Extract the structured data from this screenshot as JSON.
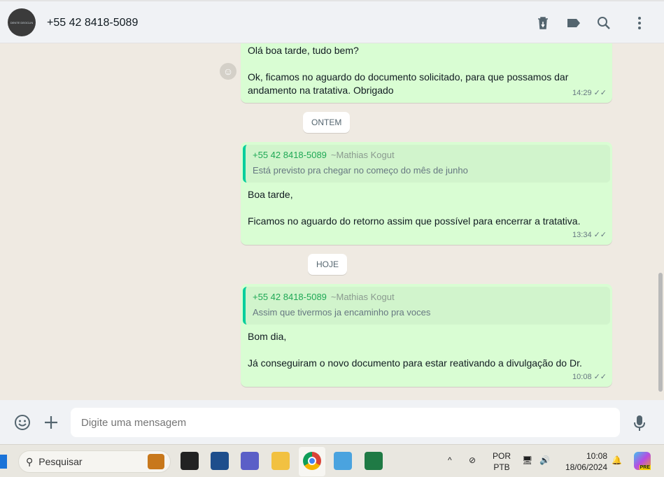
{
  "header": {
    "contact": "+55 42 8418-5089",
    "avatar_text": "DENTE DEOCLIN"
  },
  "messages": [
    {
      "lines": [
        "Olá boa tarde, tudo bem?",
        "",
        "Ok, ficamos no aguardo do documento solicitado, para que possamos dar andamento na tratativa. Obrigado"
      ],
      "time": "14:29"
    },
    {
      "quote": {
        "name": "+55 42 8418-5089",
        "alias": "~Mathias Kogut",
        "text": "Está previsto pra chegar no começo do mês de junho"
      },
      "lines": [
        "Boa tarde,",
        "",
        "Ficamos no aguardo do retorno assim que possível para encerrar a tratativa."
      ],
      "time": "13:34"
    },
    {
      "quote": {
        "name": "+55 42 8418-5089",
        "alias": "~Mathias Kogut",
        "text": "Assim que tivermos ja encaminho pra voces"
      },
      "lines": [
        "Bom dia,",
        "",
        "Já conseguiram o novo documento para estar reativando a divulgação do Dr."
      ],
      "time": "10:08"
    }
  ],
  "dates": [
    "ONTEM",
    "HOJE"
  ],
  "composer": {
    "placeholder": "Digite uma mensagem"
  },
  "taskbar": {
    "search": "Pesquisar",
    "lang1": "POR",
    "lang2": "PTB",
    "clock": "10:08",
    "date": "18/06/2024",
    "copilot_badge": "PRE"
  }
}
